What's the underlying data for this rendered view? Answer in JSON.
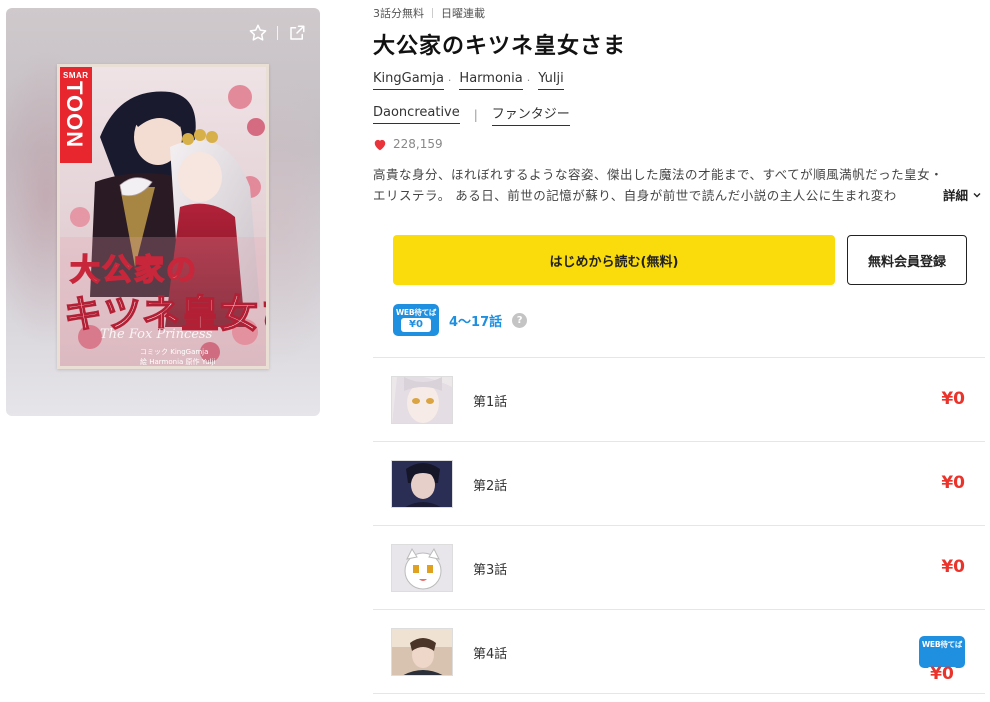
{
  "cover": {
    "brand_top": "SMAR",
    "brand_main": "TOON",
    "art_title_line1": "大公家の",
    "art_title_line2": "キツネ皇女さま",
    "art_subtitle": "The Fox Princess",
    "art_credit_1": "コミック KingGamja",
    "art_credit_2": "絵 Harmonia  原作 Yulji"
  },
  "meta": {
    "free_count": "3話分無料",
    "schedule": "日曜連載"
  },
  "title": "大公家のキツネ皇女さま",
  "authors": [
    {
      "name": "KingGamja",
      "sep": "·"
    },
    {
      "name": "Harmonia",
      "sep": "·"
    },
    {
      "name": "Yulji",
      "sep": ""
    }
  ],
  "publisher": "Daoncreative",
  "genre": "ファンタジー",
  "tag_separator": "|",
  "likes": "228,159",
  "description": {
    "line1": "高貴な身分、ほれぼれするような容姿、傑出した魔法の才能まで、すべてが順風満帆だった皇女・",
    "line2": "エリステラ。 ある日、前世の記憶が蘇り、自身が前世で読んだ小説の主人公に生まれ変わ",
    "more_label": "詳細"
  },
  "buttons": {
    "read": "はじめから読む(無料)",
    "signup": "無料会員登録"
  },
  "wait_free": {
    "badge_top": "WEB待てば",
    "badge_price": "¥0",
    "range": "4～17話",
    "help": "?"
  },
  "episodes": [
    {
      "label": "第1話",
      "price": "¥0"
    },
    {
      "label": "第2話",
      "price": "¥0"
    },
    {
      "label": "第3話",
      "price": "¥0"
    },
    {
      "label": "第4話",
      "badge_top": "WEB待てば",
      "badge_price": "¥0"
    }
  ],
  "colors": {
    "accent_yellow": "#fadb0b",
    "price_red": "#e9332b",
    "wait_blue": "#1f8fe0",
    "like_red": "#e8343a"
  }
}
